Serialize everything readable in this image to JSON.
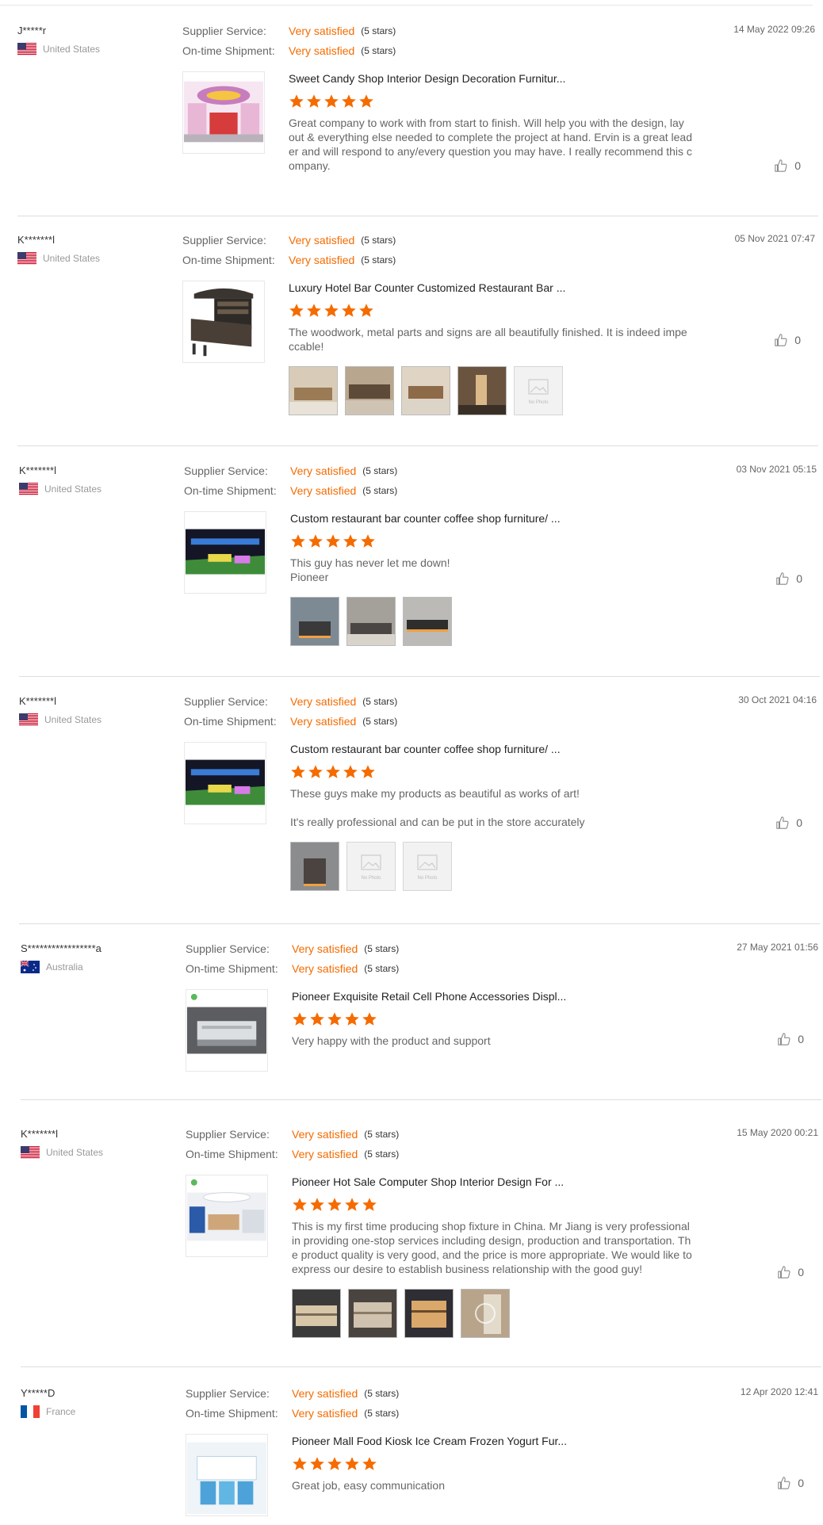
{
  "labels": {
    "supplier_service": "Supplier Service:",
    "on_time_shipment": "On-time Shipment:"
  },
  "colors": {
    "accent": "#f56b00",
    "star": "#f56b00",
    "divider": "#dddddd"
  },
  "icons": {
    "like": "thumbs-up-icon",
    "star": "star-icon",
    "no_photo": "no-photo-icon"
  },
  "reviews": [
    {
      "reviewer": "J*****r",
      "country": "United States",
      "flag": "us",
      "date": "14 May 2022 09:26",
      "supplier_service": "Very satisfied",
      "supplier_stars": "(5 stars)",
      "shipment": "Very satisfied",
      "shipment_stars": "(5 stars)",
      "product_title": "Sweet Candy Shop Interior Design Decoration Furnitur...",
      "rating": 5,
      "comment": "Great company to work with from start to finish. Will help you with the design, lay\nout & everything else needed to complete the project at hand. Ervin is a great lead\ner and will respond to any/every question you may have. I really recommend this c\nompany.",
      "photos": [],
      "likes": "0"
    },
    {
      "reviewer": "K*******l",
      "country": "United States",
      "flag": "us",
      "date": "05 Nov 2021 07:47",
      "supplier_service": "Very satisfied",
      "supplier_stars": "(5 stars)",
      "shipment": "Very satisfied",
      "shipment_stars": "(5 stars)",
      "product_title": "Luxury Hotel Bar Counter Customized Restaurant Bar ...",
      "rating": 5,
      "comment": "The woodwork, metal parts and signs are all beautifully finished. It is indeed impe\nccable!",
      "photos": [
        "photo",
        "photo",
        "photo",
        "photo",
        "No Photo"
      ],
      "likes": "0"
    },
    {
      "reviewer": "K*******l",
      "country": "United States",
      "flag": "us",
      "date": "03 Nov 2021 05:15",
      "supplier_service": "Very satisfied",
      "supplier_stars": "(5 stars)",
      "shipment": "Very satisfied",
      "shipment_stars": "(5 stars)",
      "product_title": "Custom restaurant bar counter coffee shop furniture/ ...",
      "rating": 5,
      "comment": "This guy has never let me down!\nPioneer",
      "photos": [
        "photo",
        "photo",
        "photo"
      ],
      "likes": "0"
    },
    {
      "reviewer": "K*******l",
      "country": "United States",
      "flag": "us",
      "date": "30 Oct 2021 04:16",
      "supplier_service": "Very satisfied",
      "supplier_stars": "(5 stars)",
      "shipment": "Very satisfied",
      "shipment_stars": "(5 stars)",
      "product_title": "Custom restaurant bar counter coffee shop furniture/ ...",
      "rating": 5,
      "comment": "These guys make my products as beautiful as works of art!\n\nIt's really professional and can be put in the store accurately",
      "photos": [
        "photo",
        "No Photo",
        "No Photo"
      ],
      "likes": "0"
    },
    {
      "reviewer": "S*****************a",
      "country": "Australia",
      "flag": "au",
      "date": "27 May 2021 01:56",
      "supplier_service": "Very satisfied",
      "supplier_stars": "(5 stars)",
      "shipment": "Very satisfied",
      "shipment_stars": "(5 stars)",
      "product_title": "Pioneer Exquisite Retail Cell Phone Accessories Displ...",
      "rating": 5,
      "comment": "Very happy with the product and support",
      "photos": [],
      "likes": "0"
    },
    {
      "reviewer": "K*******l",
      "country": "United States",
      "flag": "us",
      "date": "15 May 2020 00:21",
      "supplier_service": "Very satisfied",
      "supplier_stars": "(5 stars)",
      "shipment": "Very satisfied",
      "shipment_stars": "(5 stars)",
      "product_title": "Pioneer Hot Sale Computer Shop Interior Design For ...",
      "rating": 5,
      "comment": "This is my first time producing shop fixture in China. Mr Jiang is very professional\nin providing one-stop services including design, production and transportation. Th\ne product quality is very good, and the price is more appropriate. We would like to\nexpress our desire to establish business relationship with the good guy!",
      "photos": [
        "photo",
        "photo",
        "photo",
        "photo"
      ],
      "likes": "0"
    },
    {
      "reviewer": "Y*****D",
      "country": "France",
      "flag": "fr",
      "date": "12 Apr 2020 12:41",
      "supplier_service": "Very satisfied",
      "supplier_stars": "(5 stars)",
      "shipment": "Very satisfied",
      "shipment_stars": "(5 stars)",
      "product_title": "Pioneer Mall Food Kiosk Ice Cream Frozen Yogurt Fur...",
      "rating": 5,
      "comment": "Great job, easy communication",
      "photos": [],
      "likes": "0"
    }
  ]
}
